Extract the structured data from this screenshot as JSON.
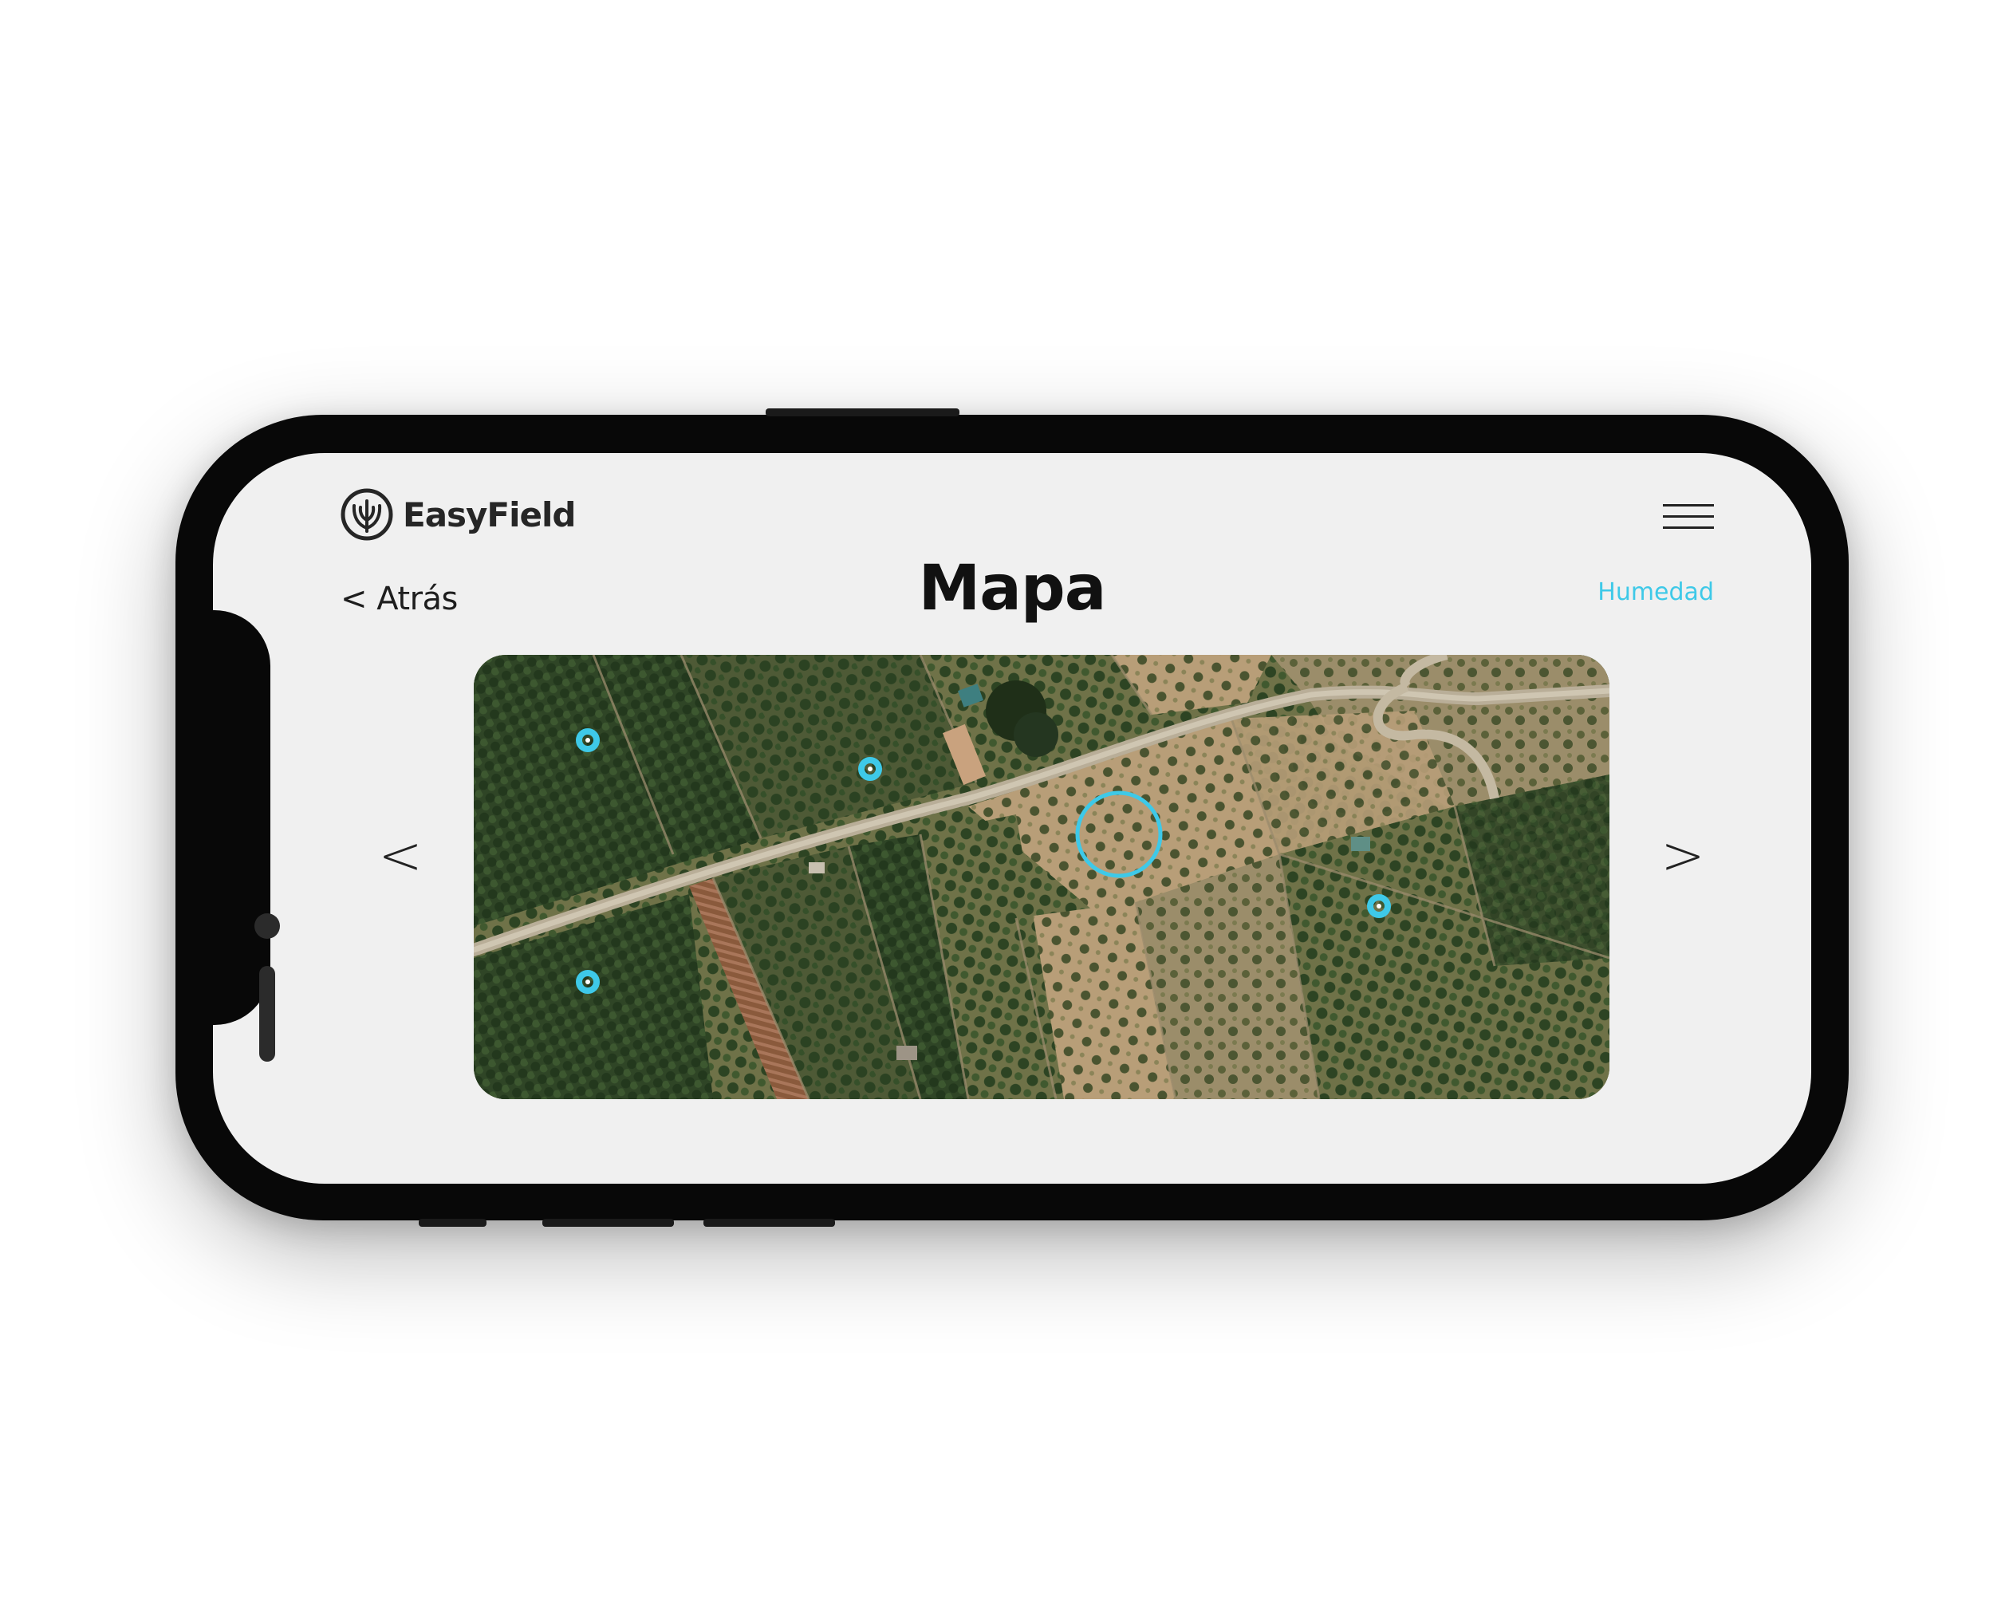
{
  "app": {
    "brand_name": "EasyField"
  },
  "header": {
    "back_label": "< Atrás",
    "title": "Mapa",
    "filter_label": "Humedad"
  },
  "navigation": {
    "prev_label": "<",
    "next_label": ">"
  },
  "colors": {
    "accent": "#3ec9e8",
    "background": "#f0f0f0",
    "text": "#111111"
  },
  "icons": {
    "brand": "tree-leaf-icon",
    "menu": "hamburger-menu-icon"
  },
  "map": {
    "type": "satellite",
    "sensor_count": 5,
    "selected_sensor": "center"
  }
}
